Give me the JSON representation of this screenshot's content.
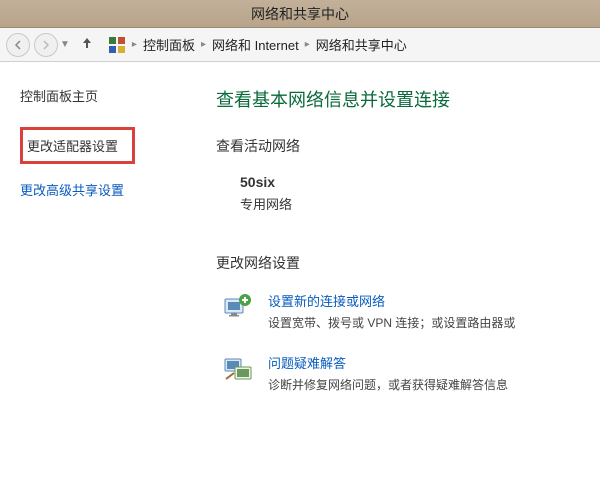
{
  "window_title": "网络和共享中心",
  "breadcrumb": {
    "root_icon": "control-panel",
    "items": [
      "控制面板",
      "网络和 Internet",
      "网络和共享中心"
    ]
  },
  "sidebar": {
    "heading": "控制面板主页",
    "links": [
      {
        "label": "更改适配器设置",
        "highlighted": true
      },
      {
        "label": "更改高级共享设置",
        "highlighted": false
      }
    ]
  },
  "main": {
    "title": "查看基本网络信息并设置连接",
    "active_networks": {
      "heading": "查看活动网络",
      "name": "50six",
      "type": "专用网络"
    },
    "change_settings": {
      "heading": "更改网络设置",
      "items": [
        {
          "icon": "new-connection-icon",
          "title": "设置新的连接或网络",
          "desc": "设置宽带、拨号或 VPN 连接；或设置路由器或"
        },
        {
          "icon": "troubleshoot-icon",
          "title": "问题疑难解答",
          "desc": "诊断并修复网络问题，或者获得疑难解答信息"
        }
      ]
    }
  }
}
